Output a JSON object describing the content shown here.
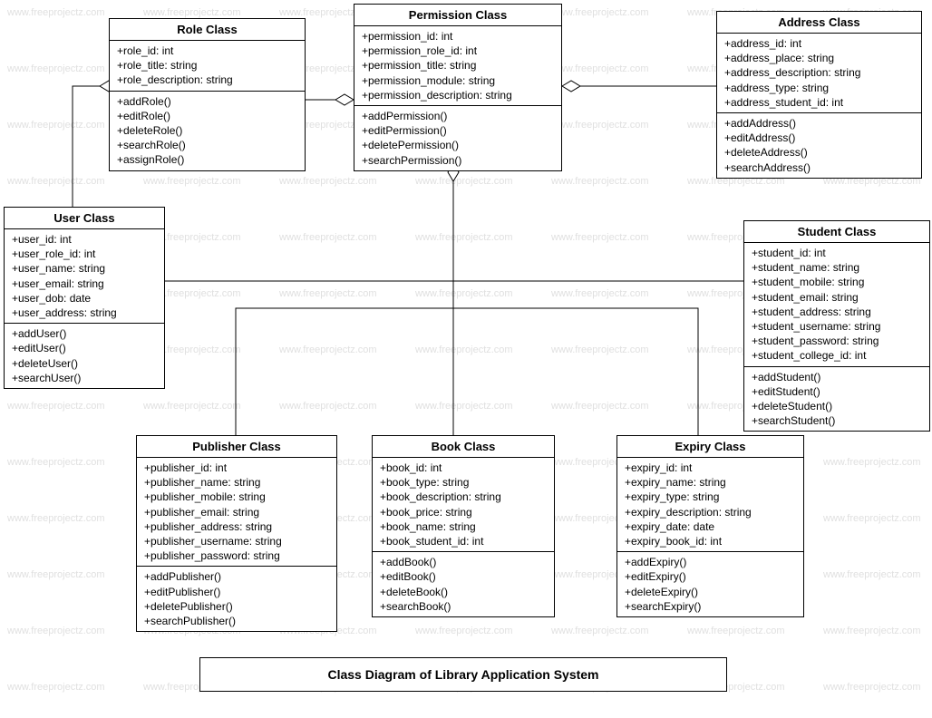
{
  "title": "Class Diagram of Library Application System",
  "watermark": "www.freeprojectz.com",
  "classes": {
    "role": {
      "name": "Role Class",
      "attrs": [
        "+role_id: int",
        "+role_title: string",
        "+role_description: string"
      ],
      "methods": [
        "+addRole()",
        "+editRole()",
        "+deleteRole()",
        "+searchRole()",
        "+assignRole()"
      ]
    },
    "permission": {
      "name": "Permission Class",
      "attrs": [
        "+permission_id: int",
        "+permission_role_id: int",
        "+permission_title: string",
        "+permission_module: string",
        "+permission_description: string"
      ],
      "methods": [
        "+addPermission()",
        "+editPermission()",
        "+deletePermission()",
        "+searchPermission()"
      ]
    },
    "address": {
      "name": "Address Class",
      "attrs": [
        "+address_id: int",
        "+address_place: string",
        "+address_description: string",
        "+address_type: string",
        "+address_student_id: int"
      ],
      "methods": [
        "+addAddress()",
        "+editAddress()",
        "+deleteAddress()",
        "+searchAddress()"
      ]
    },
    "user": {
      "name": "User Class",
      "attrs": [
        "+user_id: int",
        "+user_role_id: int",
        "+user_name: string",
        "+user_email: string",
        "+user_dob: date",
        "+user_address: string"
      ],
      "methods": [
        "+addUser()",
        "+editUser()",
        "+deleteUser()",
        "+searchUser()"
      ]
    },
    "student": {
      "name": "Student Class",
      "attrs": [
        "+student_id: int",
        "+student_name: string",
        "+student_mobile: string",
        "+student_email: string",
        "+student_address: string",
        "+student_username: string",
        "+student_password: string",
        "+student_college_id: int"
      ],
      "methods": [
        "+addStudent()",
        "+editStudent()",
        "+deleteStudent()",
        "+searchStudent()"
      ]
    },
    "publisher": {
      "name": "Publisher Class",
      "attrs": [
        "+publisher_id: int",
        "+publisher_name: string",
        "+publisher_mobile: string",
        "+publisher_email: string",
        "+publisher_address: string",
        "+publisher_username: string",
        "+publisher_password: string"
      ],
      "methods": [
        "+addPublisher()",
        "+editPublisher()",
        "+deletePublisher()",
        "+searchPublisher()"
      ]
    },
    "book": {
      "name": "Book Class",
      "attrs": [
        "+book_id: int",
        "+book_type: string",
        "+book_description: string",
        "+book_price: string",
        "+book_name: string",
        "+book_student_id: int"
      ],
      "methods": [
        "+addBook()",
        "+editBook()",
        "+deleteBook()",
        "+searchBook()"
      ]
    },
    "expiry": {
      "name": "Expiry Class",
      "attrs": [
        "+expiry_id: int",
        "+expiry_name: string",
        "+expiry_type: string",
        "+expiry_description: string",
        "+expiry_date: date",
        "+expiry_book_id: int"
      ],
      "methods": [
        "+addExpiry()",
        "+editExpiry()",
        "+deleteExpiry()",
        "+searchExpiry()"
      ]
    }
  }
}
